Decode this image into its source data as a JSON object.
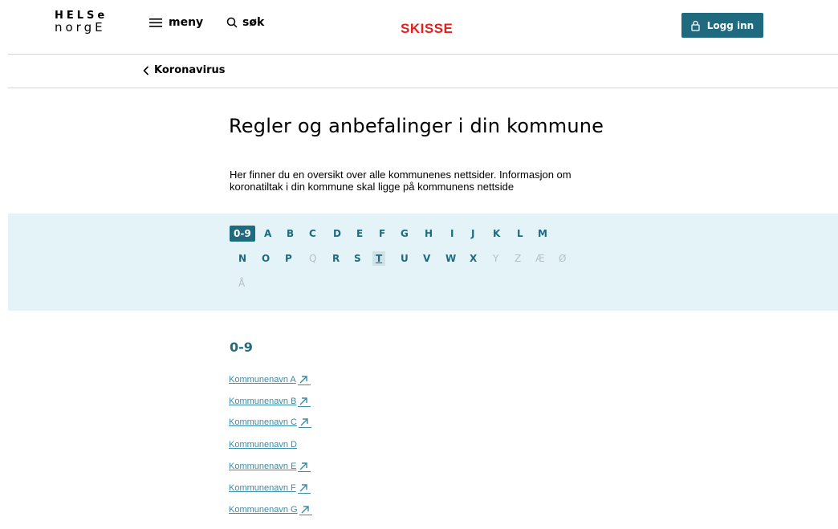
{
  "header": {
    "logo_top": "HELSe",
    "logo_bottom": "norgE",
    "menu_label": "meny",
    "search_label": "søk",
    "sketch_label": "SKISSE",
    "login_label": "Logg inn"
  },
  "breadcrumb": {
    "back_label": "Koronavirus"
  },
  "main": {
    "title": "Regler og anbefalinger i din kommune",
    "intro": "Her finner du en oversikt over alle kommunenes nettsider. Informasjon om koronatiltak i din kommune skal ligge på kommunens nettside"
  },
  "alphabet": {
    "row1": [
      "0-9",
      "A",
      "B",
      "C",
      "D",
      "E",
      "F",
      "G",
      "H",
      "I",
      "J",
      "K",
      "L",
      "M"
    ],
    "row2": [
      "N",
      "O",
      "P",
      "Q",
      "R",
      "S",
      "T",
      "U",
      "V",
      "W",
      "X",
      "Y",
      "Z",
      "Æ",
      "Ø"
    ],
    "row3": [
      "Å"
    ],
    "active": "0-9",
    "hovered": "T",
    "disabled": [
      "Q",
      "Y",
      "Z",
      "Æ",
      "Ø",
      "Å"
    ]
  },
  "section": {
    "heading": "0-9",
    "items": [
      {
        "label": "Kommunenavn A",
        "external": true
      },
      {
        "label": "Kommunenavn B",
        "external": true
      },
      {
        "label": "Kommunenavn C",
        "external": true
      },
      {
        "label": "Kommunenavn D",
        "external": false
      },
      {
        "label": "Kommunenavn E",
        "external": true
      },
      {
        "label": "Kommunenavn F",
        "external": true
      },
      {
        "label": "Kommunenavn G",
        "external": true
      }
    ]
  },
  "colors": {
    "primary": "#1f6a7f",
    "link": "#3b8aa6",
    "sketch": "#e3221e",
    "band": "#e3f3f7"
  }
}
